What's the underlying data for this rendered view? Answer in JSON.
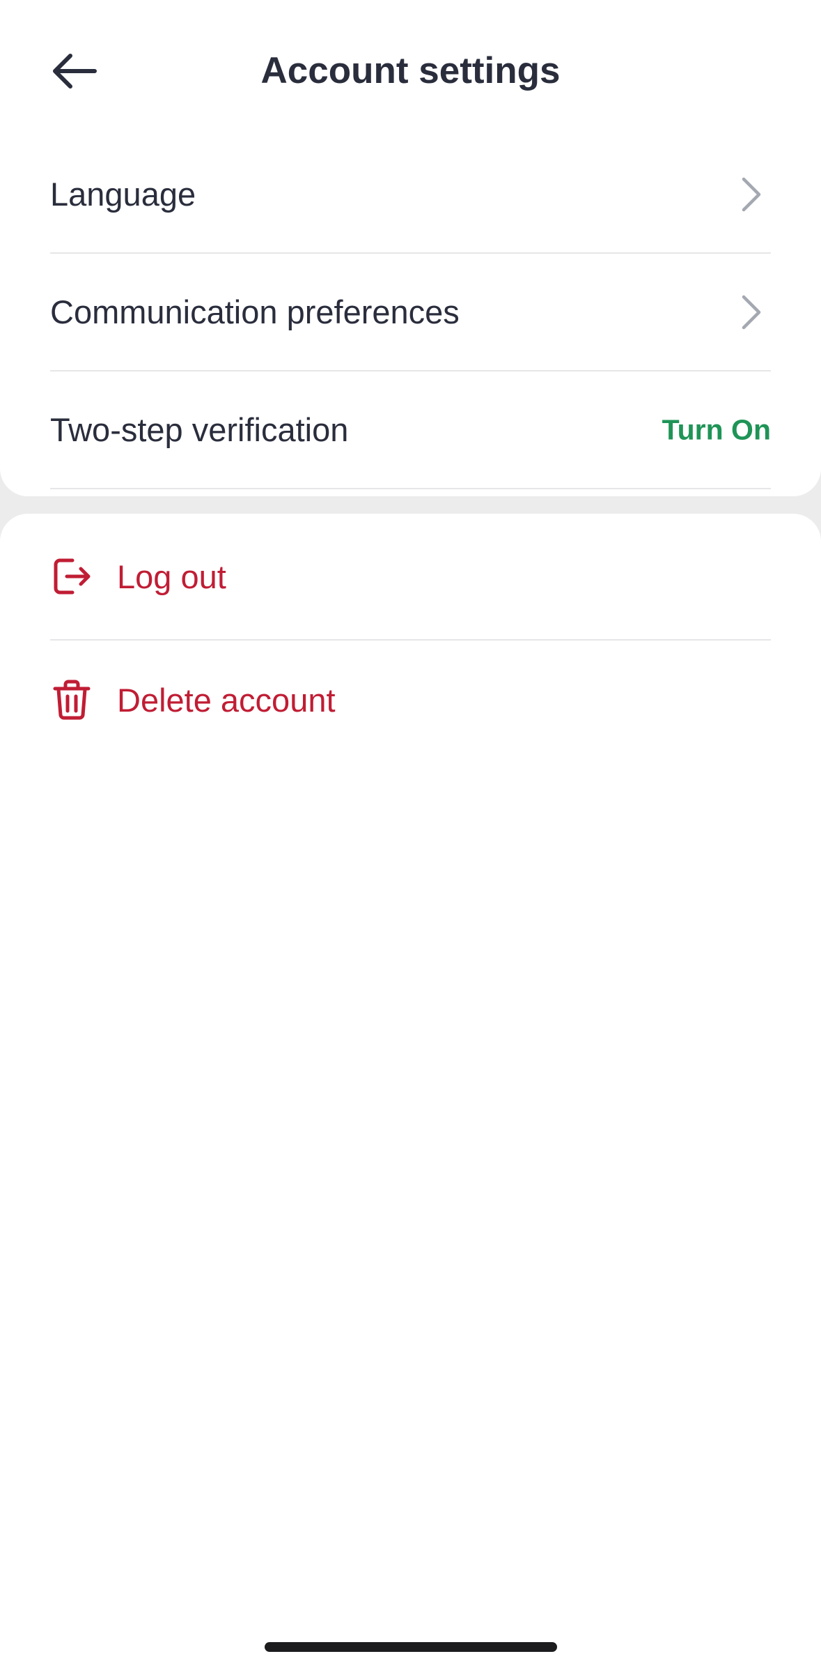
{
  "header": {
    "title": "Account settings",
    "back_icon": "arrow-left-icon"
  },
  "settings": {
    "items": [
      {
        "label": "Language",
        "trailing_icon": "chevron-right-icon"
      },
      {
        "label": "Communication preferences",
        "trailing_icon": "chevron-right-icon"
      },
      {
        "label": "Two-step verification",
        "action": "Turn On"
      }
    ]
  },
  "account_actions": {
    "items": [
      {
        "label": "Log out",
        "icon": "log-out-icon"
      },
      {
        "label": "Delete account",
        "icon": "trash-icon"
      }
    ]
  },
  "colors": {
    "text_primary": "#2a2d3c",
    "chevron": "#a3a8b1",
    "action_green": "#1f9457",
    "danger_red": "#c01d34",
    "divider": "#e6e6e8",
    "section_gap": "#ececec"
  }
}
